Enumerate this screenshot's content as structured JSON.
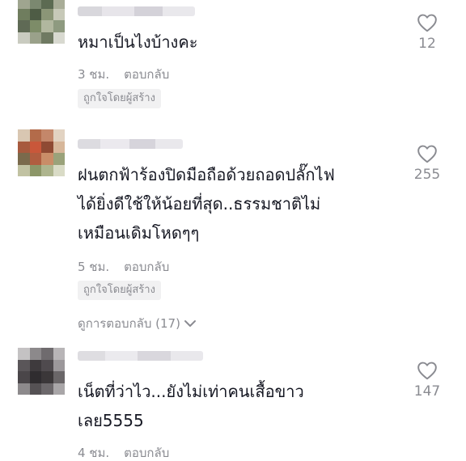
{
  "comments": [
    {
      "text": "หมาเป็นไงบ้างคะ",
      "time": "3 ชม.",
      "reply_label": "ตอบกลับ",
      "badge": "ถูกใจโดยผู้สร้าง",
      "likes": "12",
      "like_icon": "heart-outline-icon"
    },
    {
      "text": "ฝนตกฟ้าร้องปิดมือถือด้วยถอดปลั๊กไฟ\nได้ยิ่งดีใช้ให้น้อยที่สุด..ธรรมชาติไม่\nเหมือนเดิมโหดๆๆ",
      "time": "5 ชม.",
      "reply_label": "ตอบกลับ",
      "badge": "ถูกใจโดยผู้สร้าง",
      "likes": "255",
      "like_icon": "heart-outline-icon",
      "view_replies": "ดูการตอบกลับ (17)"
    },
    {
      "text": "เน็ตที่ว่าไว...ยังไม่เท่าคนเสื้อขาว\nเลย5555",
      "time": "4 ชม.",
      "reply_label": "ตอบกลับ",
      "likes": "147",
      "like_icon": "heart-outline-icon"
    }
  ],
  "colors": {
    "text_primary": "#161823",
    "text_secondary": "#8a8b91",
    "badge_bg": "#f1f1f2"
  }
}
